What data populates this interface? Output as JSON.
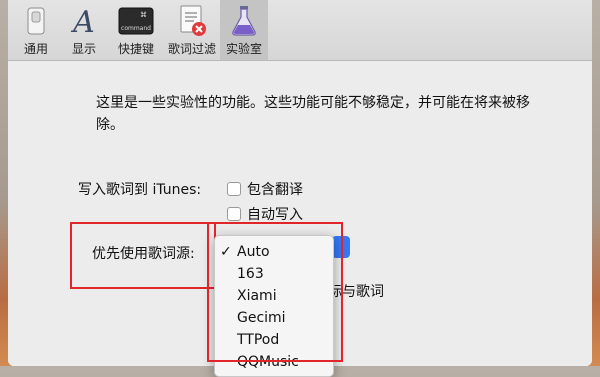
{
  "toolbar": {
    "items": [
      {
        "label": "通用",
        "icon": "switch-icon"
      },
      {
        "label": "显示",
        "icon": "font-a-icon"
      },
      {
        "label": "快捷键",
        "icon": "command-key-icon",
        "key_text": "command"
      },
      {
        "label": "歌词过滤",
        "icon": "document-block-icon"
      },
      {
        "label": "实验室",
        "icon": "flask-icon"
      }
    ],
    "active_index": 4
  },
  "content": {
    "description": "这里是一些实验性的功能。这些功能可能不够稳定，并可能在将来被移除。",
    "itunes_label": "写入歌词到 iTunes:",
    "checkbox_include_translation": "包含翻译",
    "checkbox_auto_write": "自动写入",
    "source_label": "优先使用歌词源:",
    "partial_label": "标与歌词"
  },
  "source_menu": {
    "selected": "Auto",
    "check_mark": "✓",
    "options": [
      "Auto",
      "163",
      "Xiami",
      "Gecimi",
      "TTPod",
      "QQMusic"
    ]
  },
  "colors": {
    "highlight_box": "#e0262b",
    "popup_accent": "#3478f6"
  }
}
